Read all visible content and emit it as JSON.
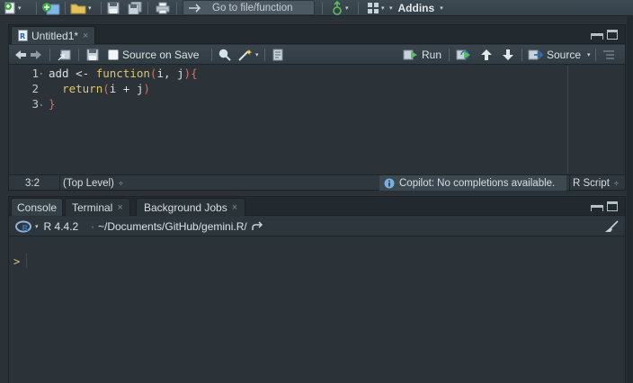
{
  "toolbar": {
    "goto_placeholder": "Go to file/function",
    "addins_label": "Addins",
    "caret": "▾"
  },
  "editor": {
    "tab_label": "Untitled1*",
    "tab_close": "×",
    "source_on_save_label": "Source on Save",
    "source_on_save_checked": false,
    "run_label": "Run",
    "source_label": "Source",
    "lines": [
      {
        "number": "1",
        "fold": "▾"
      },
      {
        "number": "2",
        "fold": ""
      },
      {
        "number": "3",
        "fold": "▴"
      }
    ],
    "code": {
      "l1_name": "add",
      "l1_assign": " <- ",
      "l1_function": "function",
      "l1_open": "(",
      "l1_args": "i, j",
      "l1_close": ")",
      "l1_brace": "{",
      "l2_indent": "  ",
      "l2_return": "return",
      "l2_open": "(",
      "l2_body": "i + j",
      "l2_close": ")",
      "l3_brace": "}"
    },
    "status": {
      "position": "3:2",
      "scope": "(Top Level)",
      "scope_caret": "÷",
      "copilot": "Copilot: No completions available.",
      "file_type": "R Script",
      "file_type_caret": "÷"
    }
  },
  "console": {
    "tabs": [
      {
        "label": "Console",
        "active": true,
        "closable": false
      },
      {
        "label": "Terminal",
        "active": false,
        "closable": true
      },
      {
        "label": "Background Jobs",
        "active": false,
        "closable": true
      }
    ],
    "r_version": "R 4.4.2",
    "path": "~/Documents/GitHub/gemini.R/",
    "prompt": ">"
  },
  "colors": {
    "background": "#2a3238",
    "keyword": "#e0c46c",
    "bracket": "#e06b5d",
    "accent_green": "#5bbd5b"
  }
}
